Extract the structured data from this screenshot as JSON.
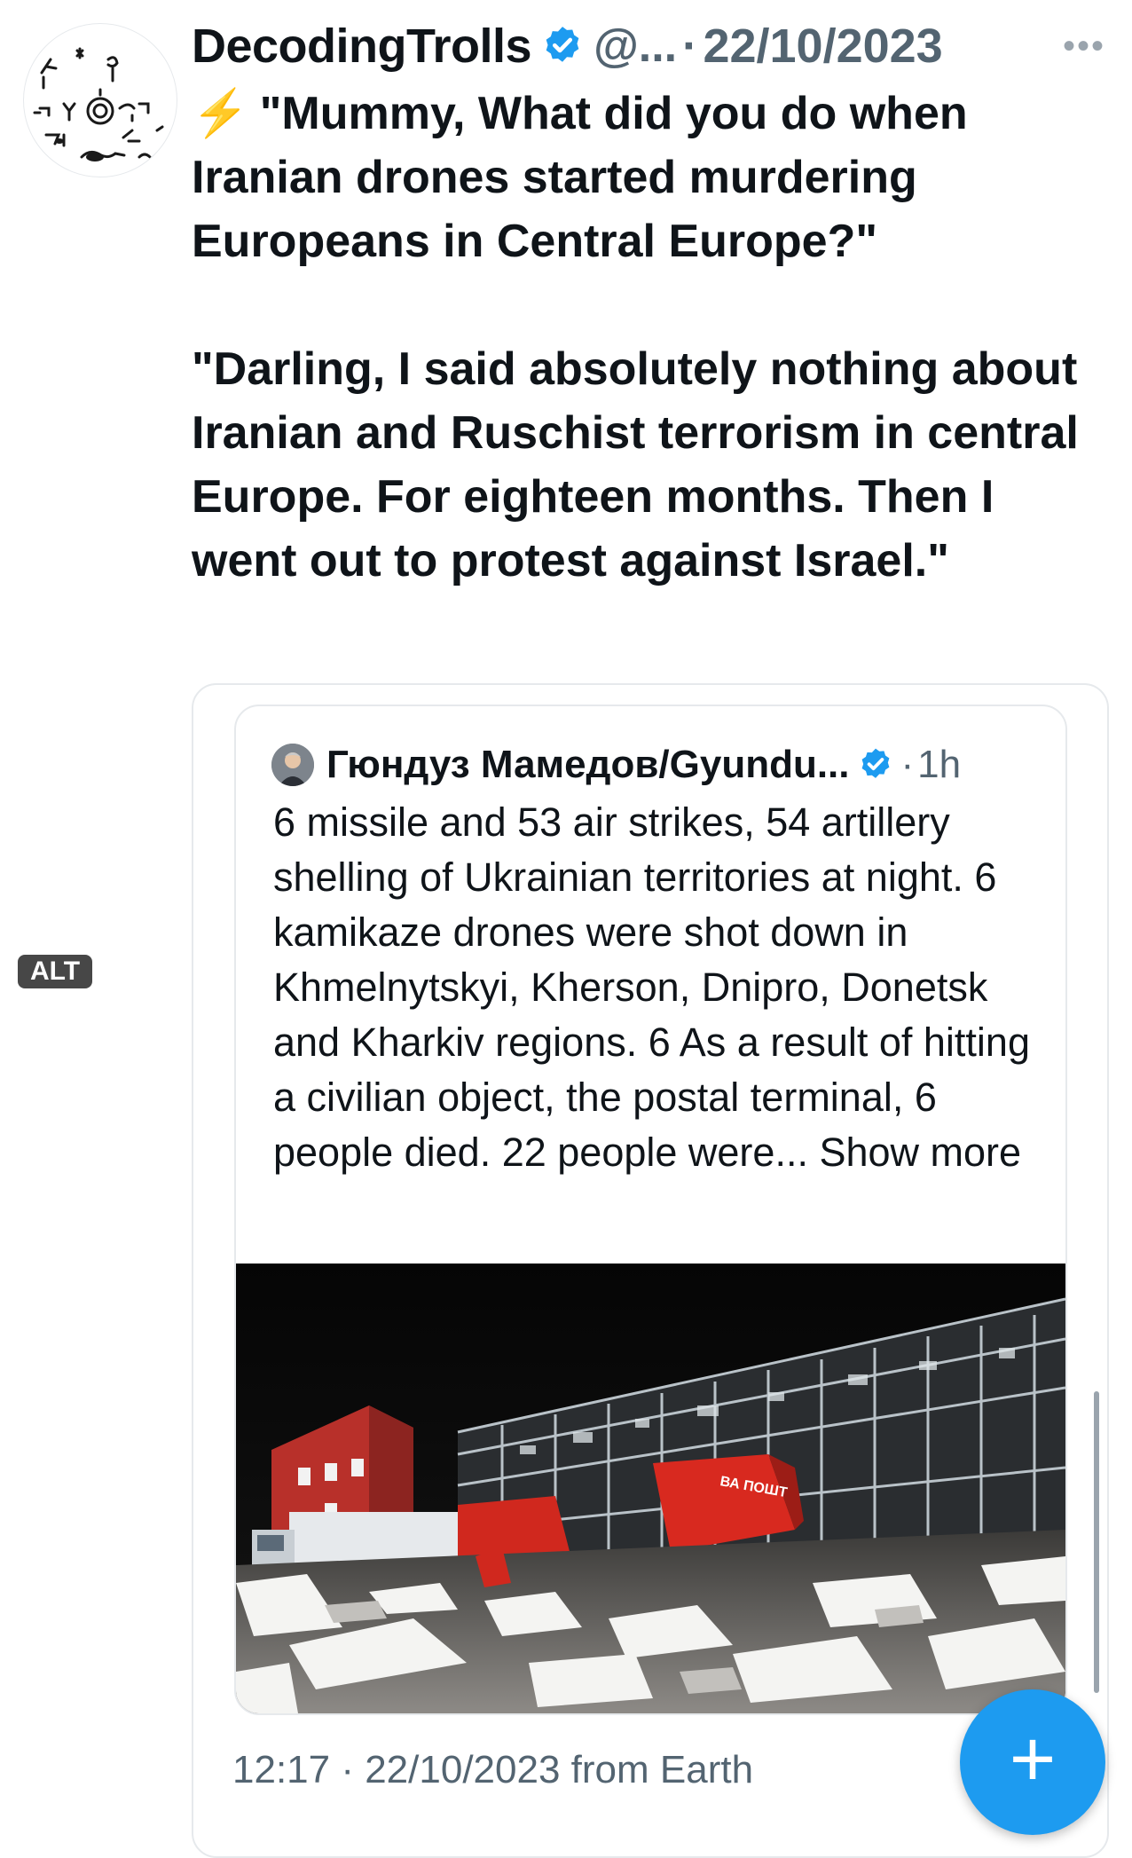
{
  "tweet": {
    "author": {
      "name": "DecodingTrolls",
      "handle": "@...",
      "verified": true
    },
    "date": "22/10/2023",
    "separator": "·",
    "more_icon": "more-horizontal-icon",
    "text": {
      "emoji": "⚡",
      "para1": "\"Mummy, What did you do when Iranian drones started murdering Europeans in Central Europe?\"",
      "para2": "\"Darling, I said absolutely nothing about Iranian and Ruschist terrorism in central Europe. For eighteen months. Then I went out to protest against Israel.\""
    }
  },
  "quoted_tweet": {
    "author": {
      "name": "Гюндуз Мамедов/Gyundu...",
      "verified": true
    },
    "time": "1h",
    "separator": "·",
    "text": "6 missile and 53 air strikes, 54 artillery shelling of Ukrainian territories at night. 6 kamikaze drones were shot down in Khmelnytskyi, Kherson, Dnipro, Donetsk and Kharkiv regions. 6 As a result of hitting a civilian object, the postal terminal, 6 people died. 22 people were...",
    "show_more": "Show more",
    "image": {
      "alt_badge": "ALT",
      "truck_sign": "ВА ПОШТ"
    }
  },
  "meta": {
    "timestamp": "12:17 · 22/10/2023 from Earth"
  },
  "fab": {
    "label": "+"
  },
  "colors": {
    "accent": "#1d9bf0",
    "text": "#0f1419",
    "secondary": "#536471",
    "border": "#e6e9ec",
    "bolt": "#f5a623"
  }
}
